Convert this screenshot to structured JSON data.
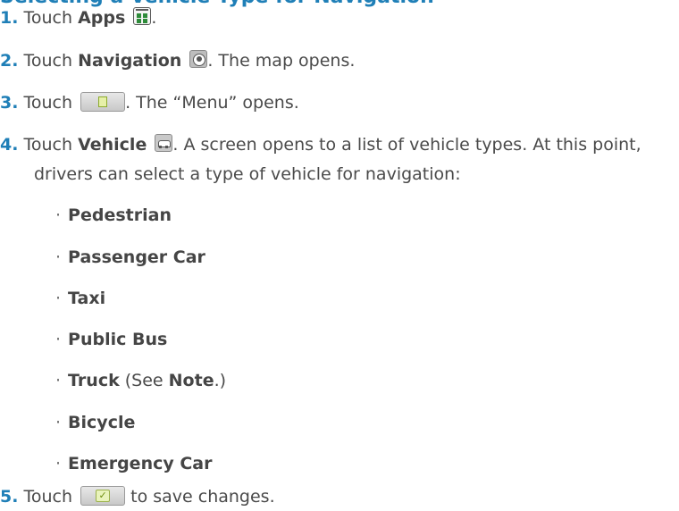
{
  "heading": "Selecting a Vehicle Type for Navigation",
  "steps": [
    {
      "num": "1.",
      "pre": "Touch ",
      "bold": "Apps",
      "post": "."
    },
    {
      "num": "2.",
      "pre": "Touch ",
      "bold": "Navigation",
      "post": ". The map opens."
    },
    {
      "num": "3.",
      "pre": "Touch ",
      "post": ". The “Menu” opens."
    },
    {
      "num": "4.",
      "pre": "Touch ",
      "bold": "Vehicle",
      "post": ". A screen opens to a list of vehicle types. At this point,",
      "post2": "drivers can select a type of vehicle for navigation:"
    },
    {
      "num": "5.",
      "pre": "Touch ",
      "post": " to save changes."
    }
  ],
  "vehicle_types": [
    {
      "label": "Pedestrian"
    },
    {
      "label": "Passenger Car"
    },
    {
      "label": "Taxi"
    },
    {
      "label": "Public Bus"
    },
    {
      "label": "Truck",
      "suffix_pre": " (See ",
      "suffix_bold": "Note",
      "suffix_post": ".)"
    },
    {
      "label": "Bicycle"
    },
    {
      "label": "Emergency Car"
    }
  ],
  "bullet_char": "·",
  "icons": {
    "apps": "apps-icon",
    "navigation": "navigation-icon",
    "menu": "menu-button-icon",
    "vehicle": "vehicle-icon",
    "save": "save-check-button-icon"
  },
  "colors": {
    "accent": "#1f7fb7",
    "text": "#4a4a4a"
  }
}
